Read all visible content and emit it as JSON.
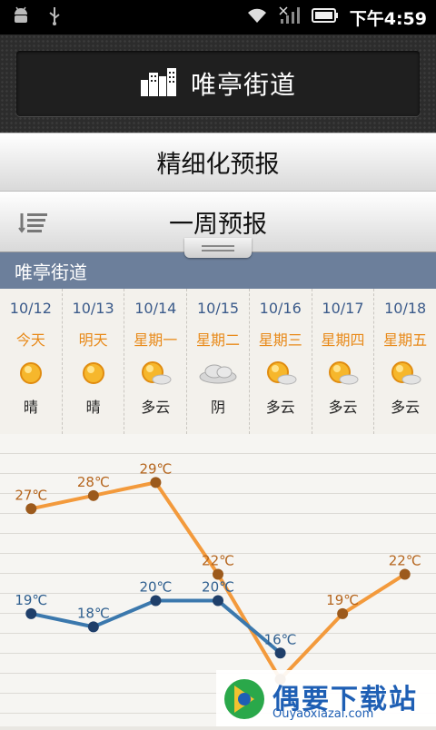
{
  "status_bar": {
    "time": "下午4:59"
  },
  "header": {
    "city": "唯亭街道"
  },
  "tabs": {
    "fine_forecast": "精细化预报",
    "week_forecast": "一周预报"
  },
  "location_label": "唯亭街道",
  "days": [
    {
      "date": "10/12",
      "weekday": "今天",
      "condition": "晴",
      "icon": "sun-icon"
    },
    {
      "date": "10/13",
      "weekday": "明天",
      "condition": "晴",
      "icon": "sun-icon"
    },
    {
      "date": "10/14",
      "weekday": "星期一",
      "condition": "多云",
      "icon": "partly-cloudy-icon"
    },
    {
      "date": "10/15",
      "weekday": "星期二",
      "condition": "阴",
      "icon": "cloud-icon"
    },
    {
      "date": "10/16",
      "weekday": "星期三",
      "condition": "多云",
      "icon": "partly-cloudy-icon"
    },
    {
      "date": "10/17",
      "weekday": "星期四",
      "condition": "多云",
      "icon": "partly-cloudy-icon"
    },
    {
      "date": "10/18",
      "weekday": "星期五",
      "condition": "多云",
      "icon": "partly-cloudy-icon"
    }
  ],
  "chart_data": {
    "type": "line",
    "series": [
      {
        "values": [
          27,
          28,
          29,
          22,
          14,
          19,
          22
        ],
        "labels": [
          "27℃",
          "28℃",
          "29℃",
          "22℃",
          "",
          "19℃",
          "22℃"
        ],
        "color": "#f39a3c"
      },
      {
        "values": [
          19,
          18,
          20,
          20,
          16,
          null,
          null
        ],
        "labels": [
          "19℃",
          "18℃",
          "20℃",
          "20℃",
          "16℃",
          "",
          ""
        ],
        "color": "#3b78ad"
      }
    ],
    "ylim": [
      10,
      32
    ]
  },
  "watermark": {
    "brand": "偶要下载站",
    "url": "Ouyaoxiazai.com"
  },
  "colors": {
    "high": "#f39a3c",
    "low": "#3b78ad",
    "date": "#3a5a8a",
    "weekday": "#e88a1a",
    "locbar": "#6c7f9b"
  }
}
